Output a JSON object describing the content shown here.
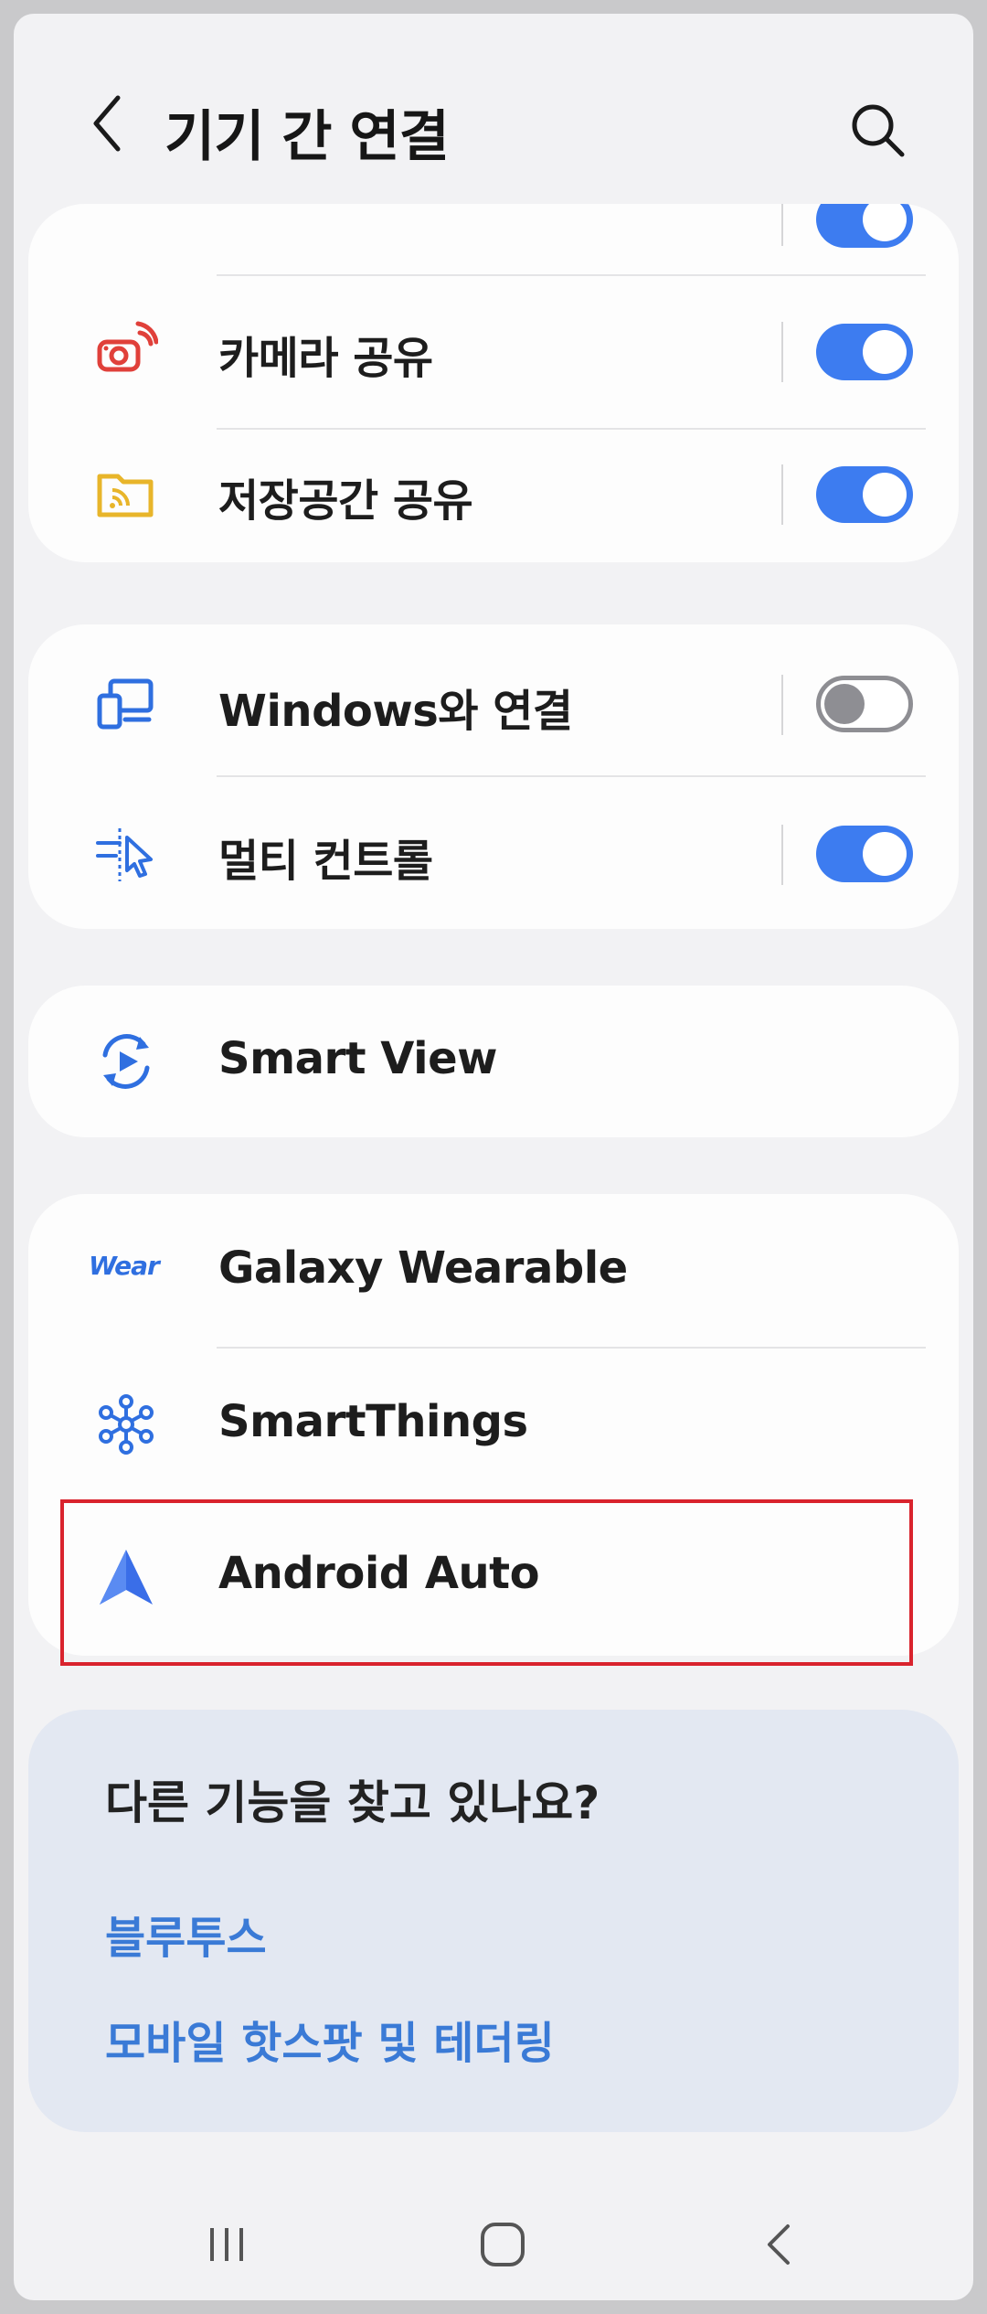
{
  "header": {
    "title": "기기 간 연결"
  },
  "card1": {
    "partial_row_label": "",
    "rows": [
      {
        "label": "카메라 공유",
        "toggle": "on",
        "icon": "camera-share-icon"
      },
      {
        "label": "저장공간 공유",
        "toggle": "on",
        "icon": "storage-share-icon"
      }
    ]
  },
  "card2": {
    "rows": [
      {
        "label": "Windows와 연결",
        "toggle": "off",
        "icon": "link-to-windows-icon"
      },
      {
        "label": "멀티 컨트롤",
        "toggle": "on",
        "icon": "multi-control-icon"
      }
    ]
  },
  "card3": {
    "rows": [
      {
        "label": "Smart View",
        "icon": "smart-view-icon"
      }
    ]
  },
  "card4": {
    "rows": [
      {
        "label": "Galaxy Wearable",
        "icon": "wear-icon",
        "icon_text": "Wear"
      },
      {
        "label": "SmartThings",
        "icon": "smartthings-icon"
      },
      {
        "label": "Android Auto",
        "icon": "android-auto-icon"
      }
    ]
  },
  "suggestions": {
    "title": "다른 기능을 찾고 있나요?",
    "links": [
      "블루투스",
      "모바일 핫스팟 및 테더링"
    ]
  },
  "colors": {
    "accent": "#3d7cf0",
    "link": "#3a7ad6",
    "highlight": "#d9232d",
    "camera_icon": "#e0403a",
    "storage_icon": "#e8b52a"
  }
}
